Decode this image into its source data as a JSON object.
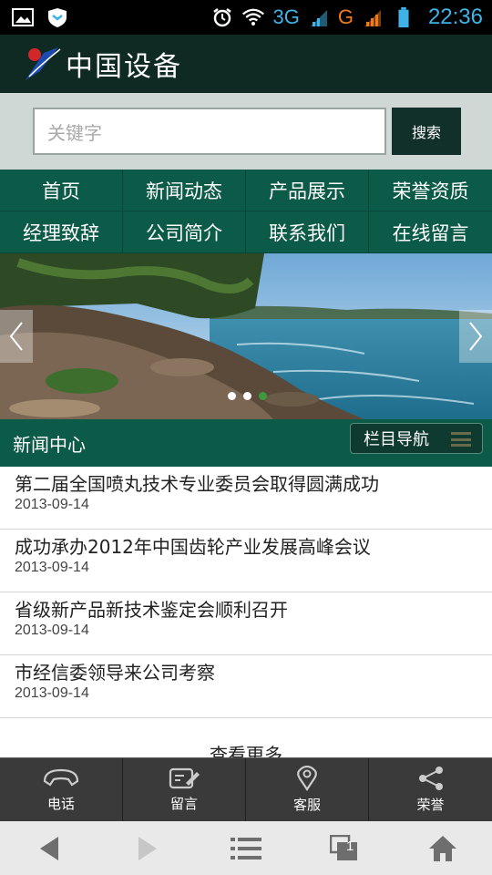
{
  "status_bar": {
    "network_3g": "3G",
    "network_g": "G",
    "network_g_sub": "2",
    "time": "22:36"
  },
  "header": {
    "logo_text": "中国设备"
  },
  "search": {
    "placeholder": "关键字",
    "button_label": "搜索"
  },
  "nav": {
    "items": [
      {
        "label": "首页"
      },
      {
        "label": "新闻动态"
      },
      {
        "label": "产品展示"
      },
      {
        "label": "荣誉资质"
      },
      {
        "label": "经理致辞"
      },
      {
        "label": "公司简介"
      },
      {
        "label": "联系我们"
      },
      {
        "label": "在线留言"
      }
    ]
  },
  "banner": {
    "active_slide_index": 2,
    "slide_count": 3
  },
  "news_section": {
    "title": "新闻中心",
    "nav_button_label": "栏目导航",
    "items": [
      {
        "title": "第二届全国喷丸技术专业委员会取得圆满成功",
        "date": "2013-09-14"
      },
      {
        "title": "成功承办2012年中国齿轮产业发展高峰会议",
        "date": "2013-09-14"
      },
      {
        "title": "省级新产品新技术鉴定会顺利召开",
        "date": "2013-09-14"
      },
      {
        "title": "市经信委领导来公司考察",
        "date": "2013-09-14"
      }
    ],
    "view_more": "查看更多"
  },
  "bottom_bar": {
    "items": [
      {
        "label": "电话",
        "icon": "phone-icon"
      },
      {
        "label": "留言",
        "icon": "edit-icon"
      },
      {
        "label": "客服",
        "icon": "location-pin-icon"
      },
      {
        "label": "荣誉",
        "icon": "share-icon"
      }
    ]
  },
  "system_nav": {
    "tabs_count": "1"
  },
  "colors": {
    "header_bg": "#0e2a22",
    "nav_bg": "#0c5a48",
    "search_bg": "#cfd8d5",
    "status_accent": "#3fb3e8"
  }
}
